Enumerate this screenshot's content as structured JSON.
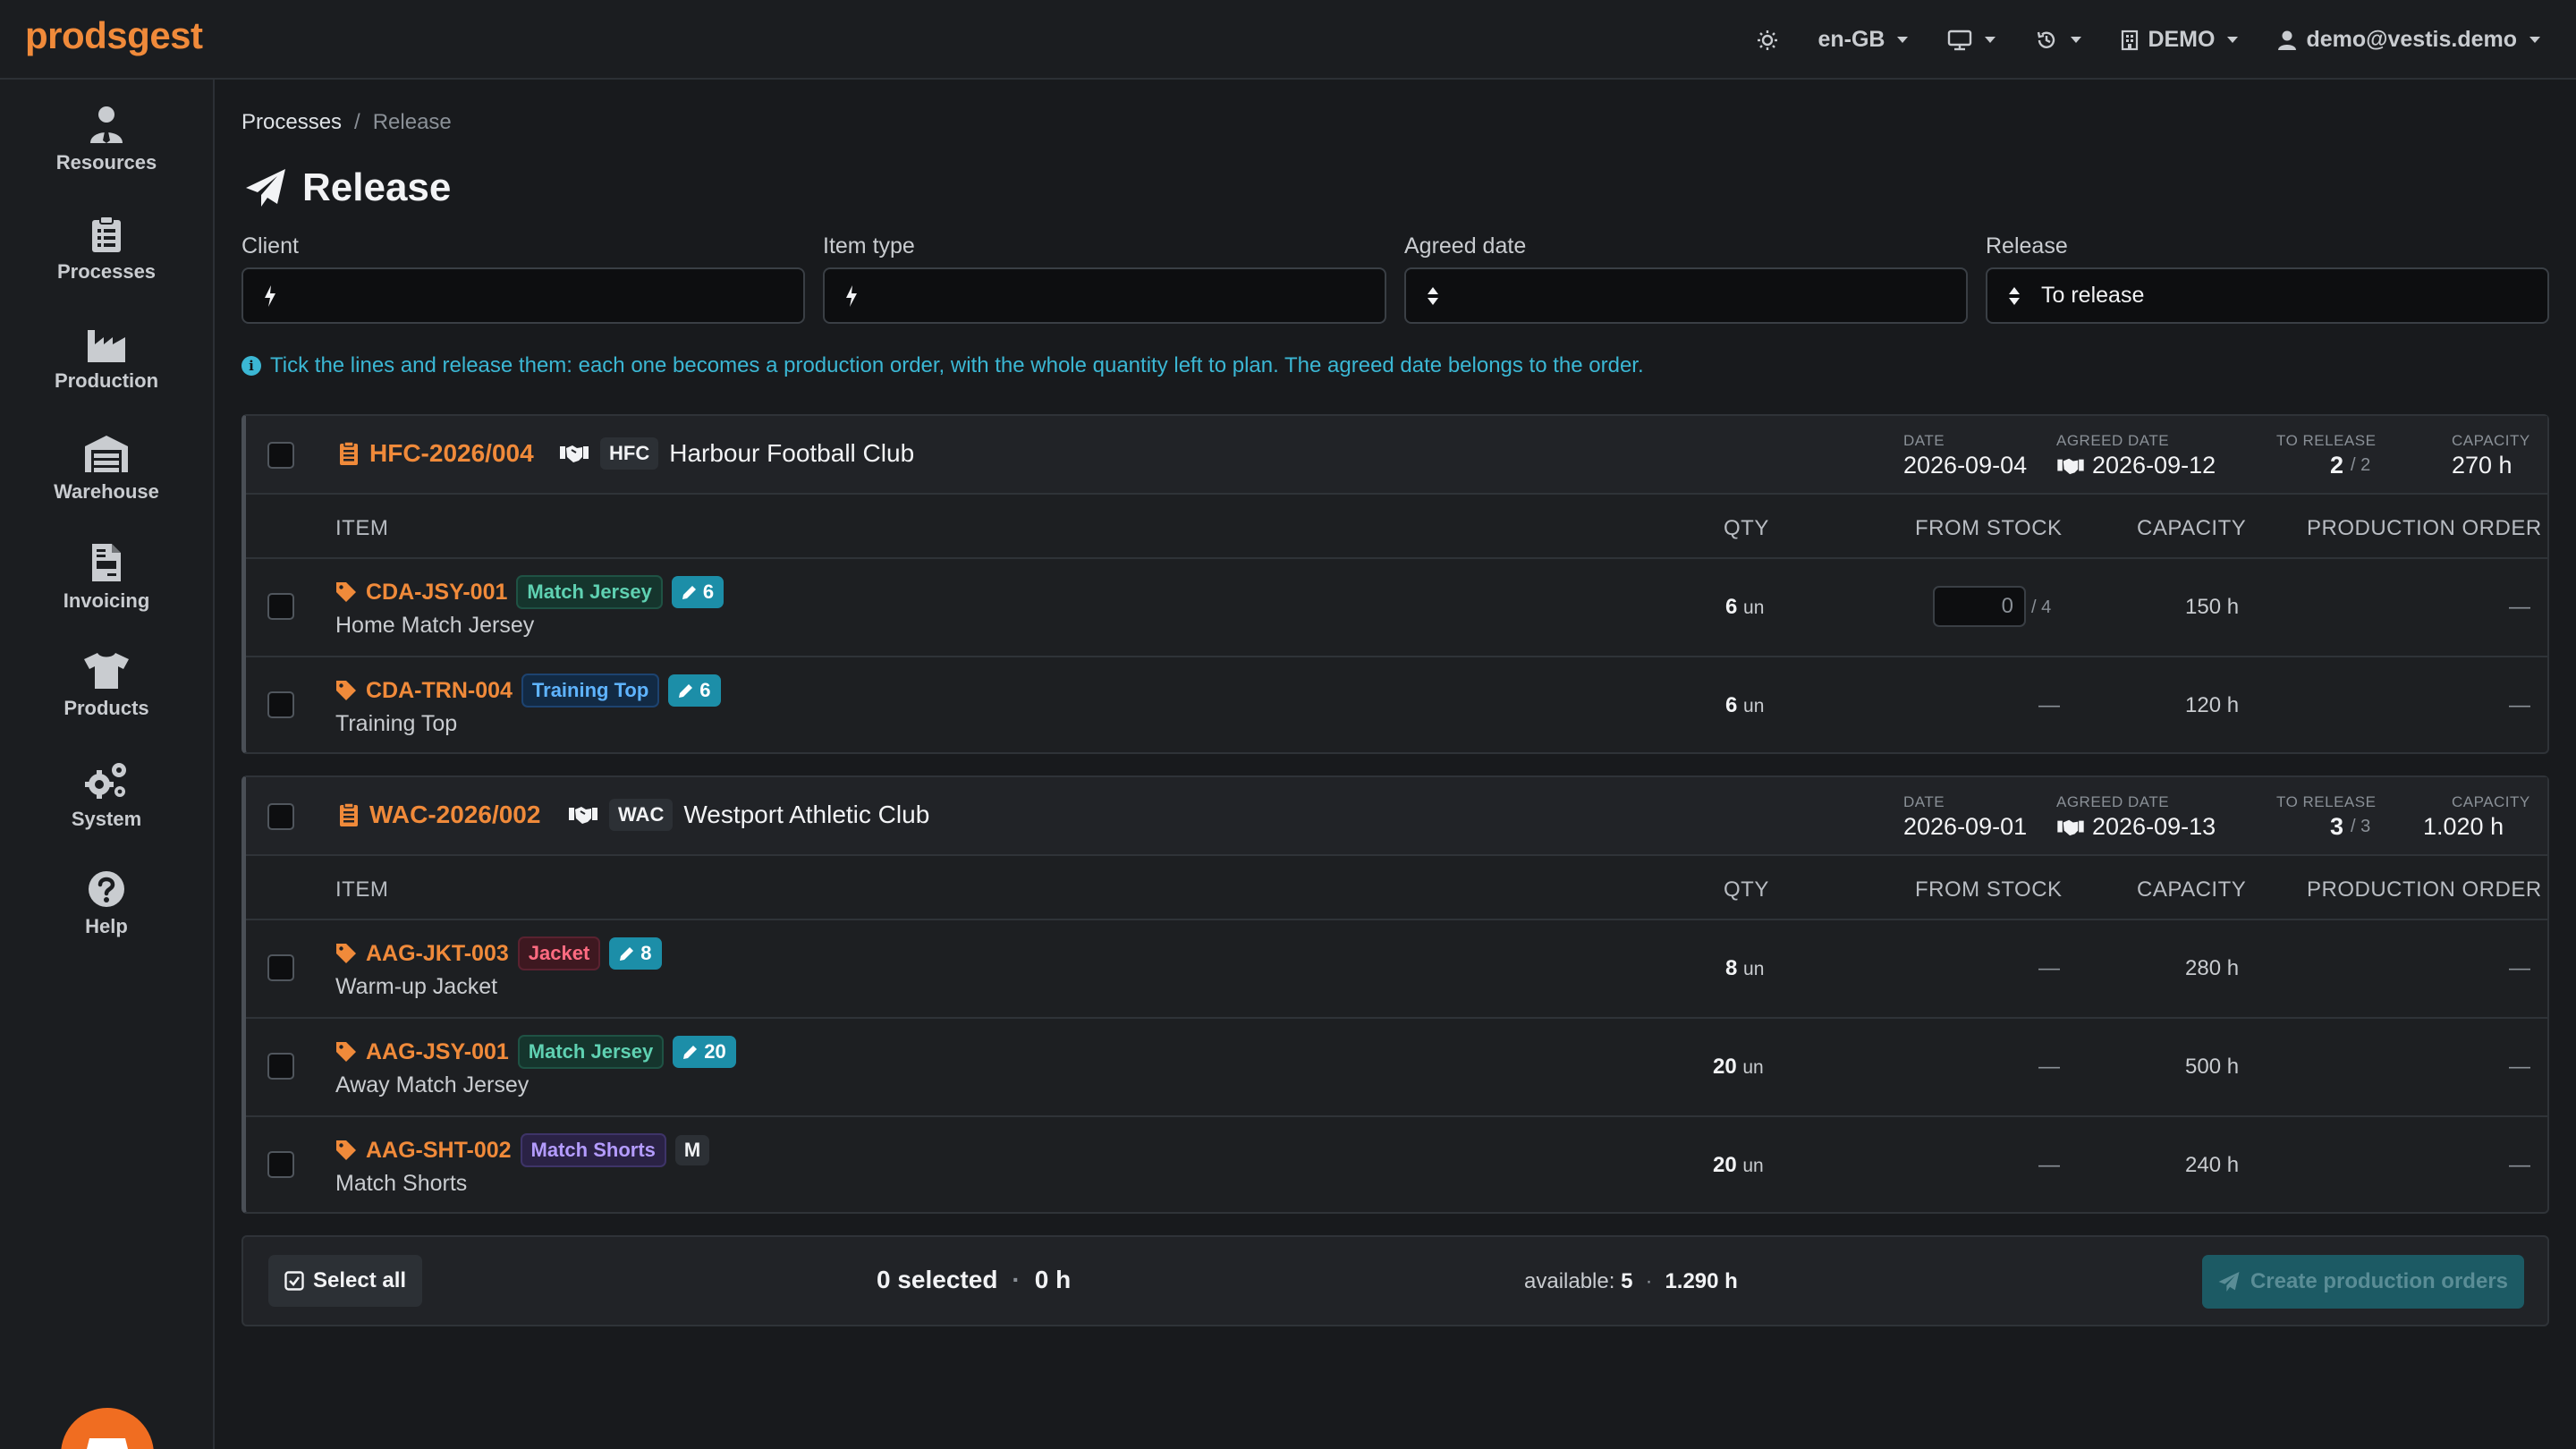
{
  "app": {
    "brand": "prodsgest"
  },
  "topnav": {
    "language": "en-GB",
    "company": "DEMO",
    "user": "demo@vestis.demo"
  },
  "sidebar": {
    "items": [
      {
        "label": "Resources",
        "icon": "user-tie-icon"
      },
      {
        "label": "Processes",
        "icon": "clipboard-list-icon"
      },
      {
        "label": "Production",
        "icon": "industry-icon"
      },
      {
        "label": "Warehouse",
        "icon": "warehouse-icon"
      },
      {
        "label": "Invoicing",
        "icon": "file-invoice-icon"
      },
      {
        "label": "Products",
        "icon": "shirt-icon"
      },
      {
        "label": "System",
        "icon": "gears-icon"
      },
      {
        "label": "Help",
        "icon": "question-circle-icon"
      }
    ],
    "fab_icon": "store-icon"
  },
  "breadcrumb": {
    "parent": "Processes",
    "separator": "/",
    "current": "Release"
  },
  "page_title": "Release",
  "filters": {
    "client_label": "Client",
    "item_type_label": "Item type",
    "agreed_date_label": "Agreed date",
    "release_label": "Release",
    "release_value": "To release"
  },
  "info_text": "Tick the lines and release them: each one becomes a production order, with the whole quantity left to plan. The agreed date belongs to the order.",
  "columns": {
    "item": "ITEM",
    "qty": "QTY",
    "from_stock": "FROM STOCK",
    "capacity": "CAPACITY",
    "production_order": "PRODUCTION ORDER"
  },
  "stat_labels": {
    "date": "DATE",
    "agreed_date": "AGREED DATE",
    "to_release": "TO RELEASE",
    "capacity": "CAPACITY"
  },
  "orders": [
    {
      "code": "HFC-2026/004",
      "client_code": "HFC",
      "client_name": "Harbour Football Club",
      "date": "2026-09-04",
      "agreed_date": "2026-09-12",
      "to_release_done": "2",
      "to_release_total": "/ 2",
      "capacity": "270 h",
      "lines": [
        {
          "sku": "CDA-JSY-001",
          "type": "Match Jersey",
          "size_badge": "6",
          "desc": "Home Match Jersey",
          "qty": "6",
          "unit": "un",
          "stock_value": "0",
          "stock_max": "/ 4",
          "capacity": "150 h",
          "order": "—"
        },
        {
          "sku": "CDA-TRN-004",
          "type": "Training Top",
          "size_badge": "6",
          "desc": "Training Top",
          "qty": "6",
          "unit": "un",
          "stock": "—",
          "capacity": "120 h",
          "order": "—"
        }
      ]
    },
    {
      "code": "WAC-2026/002",
      "client_code": "WAC",
      "client_name": "Westport Athletic Club",
      "date": "2026-09-01",
      "agreed_date": "2026-09-13",
      "to_release_done": "3",
      "to_release_total": "/ 3",
      "capacity": "1.020 h",
      "lines": [
        {
          "sku": "AAG-JKT-003",
          "type": "Jacket",
          "size_badge": "8",
          "desc": "Warm-up Jacket",
          "qty": "8",
          "unit": "un",
          "stock": "—",
          "capacity": "280 h",
          "order": "—"
        },
        {
          "sku": "AAG-JSY-001",
          "type": "Match Jersey",
          "size_badge": "20",
          "desc": "Away Match Jersey",
          "qty": "20",
          "unit": "un",
          "stock": "—",
          "capacity": "500 h",
          "order": "—"
        },
        {
          "sku": "AAG-SHT-002",
          "type": "Match Shorts",
          "size_badge": "M",
          "desc": "Match Shorts",
          "qty": "20",
          "unit": "un",
          "stock": "—",
          "capacity": "240 h",
          "order": "—"
        }
      ]
    }
  ],
  "footer": {
    "select_all": "Select all",
    "selected": "0 selected",
    "dot": "·",
    "selected_hours": "0 h",
    "available_label": "available:",
    "available_count": "5",
    "available_hours": "1.290 h",
    "create_button": "Create production orders"
  },
  "colors": {
    "accent": "#f08a3a",
    "info": "#3bb7d4",
    "primary_disabled": "#1c5a64"
  }
}
